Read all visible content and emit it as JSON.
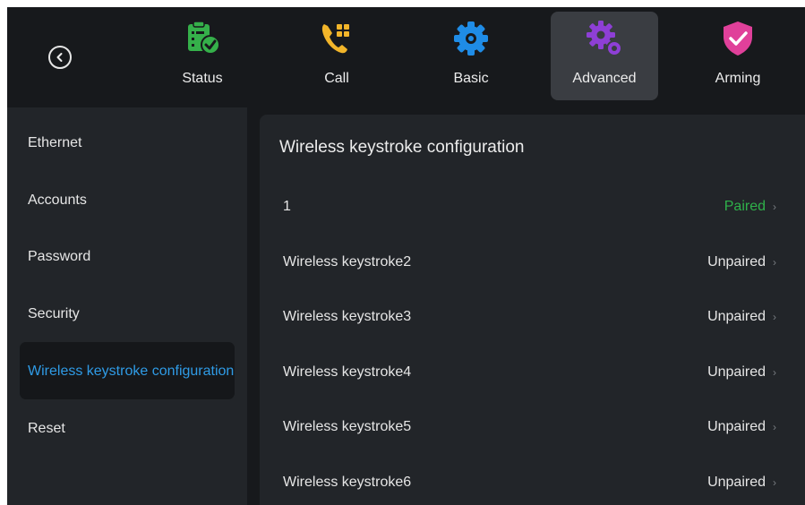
{
  "nav": {
    "tabs": [
      {
        "label": "Status",
        "icon": "clipboard-check-icon",
        "color": "#35b04a"
      },
      {
        "label": "Call",
        "icon": "phone-grid-icon",
        "color": "#f2b52a"
      },
      {
        "label": "Basic",
        "icon": "gear-icon",
        "color": "#1f8ce6"
      },
      {
        "label": "Advanced",
        "icon": "gears-icon",
        "color": "#8e3fd6"
      },
      {
        "label": "Arming",
        "icon": "shield-check-icon",
        "color": "#e0409a"
      }
    ],
    "active_tab": "Advanced"
  },
  "sidebar": {
    "items": [
      {
        "label": "Ethernet"
      },
      {
        "label": "Accounts"
      },
      {
        "label": "Password"
      },
      {
        "label": "Security"
      },
      {
        "label": "Wireless keystroke configuration"
      },
      {
        "label": "Reset"
      }
    ],
    "active_item": "Wireless keystroke configuration"
  },
  "panel": {
    "title": "Wireless keystroke configuration",
    "rows": [
      {
        "name": "1",
        "status": "Paired"
      },
      {
        "name": "Wireless keystroke2",
        "status": "Unpaired"
      },
      {
        "name": "Wireless keystroke3",
        "status": "Unpaired"
      },
      {
        "name": "Wireless keystroke4",
        "status": "Unpaired"
      },
      {
        "name": "Wireless keystroke5",
        "status": "Unpaired"
      },
      {
        "name": "Wireless keystroke6",
        "status": "Unpaired"
      }
    ]
  },
  "colors": {
    "accent": "#2f9be6",
    "paired": "#2fb14a"
  }
}
